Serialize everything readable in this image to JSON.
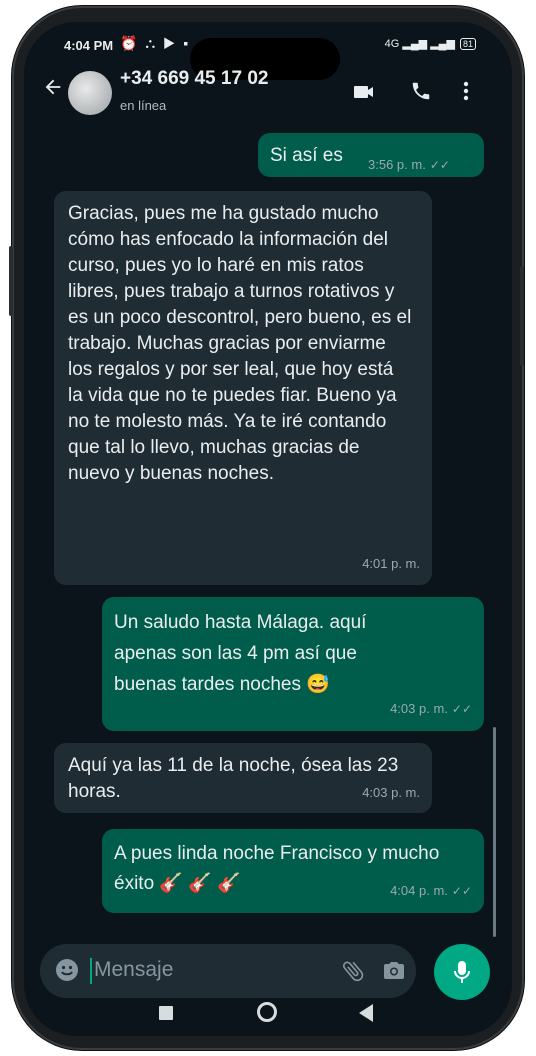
{
  "status_bar": {
    "time": "4:04 PM",
    "icons": "⏰ ⛬ ▶ ▪",
    "network": "4G",
    "battery": "81"
  },
  "header": {
    "back_icon": "arrow-left",
    "contact_name": "+34 669 45 17 02",
    "contact_status": "en línea",
    "actions": [
      "video-call",
      "voice-call",
      "more-options"
    ]
  },
  "messages": [
    {
      "direction": "outgoing",
      "text": "Si así es",
      "time": "3:56 p. m.",
      "read": true
    },
    {
      "direction": "incoming",
      "text": "Gracias, pues me ha gustado mucho cómo has enfocado la información del curso, pues yo lo haré en mis ratos libres, pues trabajo a turnos rotativos y es un poco descontrol, pero bueno, es el trabajo. Muchas gracias por enviarme los regalos y por ser leal, que hoy está la vida que no te puedes fiar. Bueno ya no te molesto más. Ya te iré contando que tal lo llevo, muchas gracias de nuevo y buenas noches.",
      "time": "4:01 p. m."
    },
    {
      "direction": "outgoing",
      "text": "Un saludo hasta Málaga. aquí apenas son las 4 pm así que buenas tardes noches 😅",
      "time": "4:03 p. m.",
      "read": true
    },
    {
      "direction": "incoming",
      "text": "Aquí ya las 11 de la noche, ósea las 23 horas.",
      "time": "4:03 p. m."
    },
    {
      "direction": "outgoing",
      "text": "A pues linda noche Francisco y mucho éxito 🎸 🎸 🎸",
      "time": "4:04 p. m.",
      "read": true
    }
  ],
  "composer": {
    "placeholder": "Mensaje"
  },
  "colors": {
    "background": "#0b141a",
    "outgoing_bubble": "#005c4b",
    "incoming_bubble": "#202c33",
    "accent": "#00a884"
  }
}
